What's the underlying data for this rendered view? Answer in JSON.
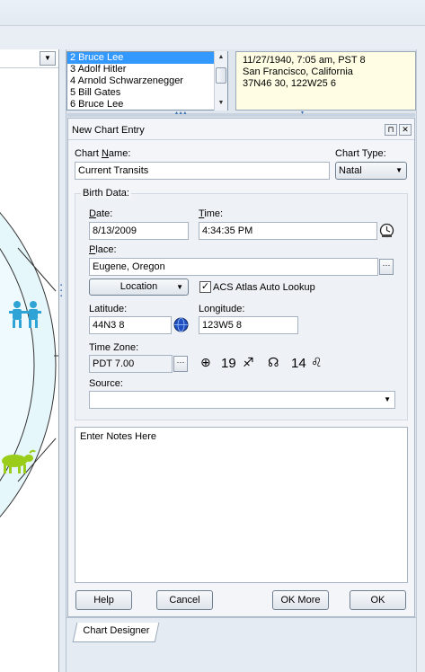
{
  "people_list": {
    "items": [
      {
        "label": "2 Bruce Lee",
        "selected": true
      },
      {
        "label": "3 Adolf Hitler",
        "selected": false
      },
      {
        "label": "4 Arnold Schwarzenegger",
        "selected": false
      },
      {
        "label": "5 Bill Gates",
        "selected": false
      },
      {
        "label": "6 Bruce Lee",
        "selected": false
      }
    ]
  },
  "info_box": {
    "line1": "11/27/1940, 7:05 am, PST 8",
    "line2": "San Francisco, California",
    "line3": "37N46 30, 122W25 6"
  },
  "panel": {
    "title": "New Chart Entry",
    "pin_glyph": "📌",
    "close_glyph": "✕"
  },
  "chart_name": {
    "label_pre": "Chart ",
    "label_mnemonic": "N",
    "label_post": "ame:",
    "value": "Current Transits"
  },
  "chart_type": {
    "label": "Chart Type:",
    "value": "Natal"
  },
  "birth_data": {
    "group_label": "Birth Data:",
    "date_label_mnemonic": "D",
    "date_label_post": "ate:",
    "date_value": "8/13/2009",
    "time_label_mnemonic": "T",
    "time_label_post": "ime:",
    "time_value": "4:34:35 PM",
    "place_label_mnemonic": "P",
    "place_label_post": "lace:",
    "place_value": "Eugene, Oregon",
    "location_button": "Location",
    "acs_label": "ACS Atlas Auto Lookup",
    "acs_checked": true,
    "latitude_label": "Latitude:",
    "latitude_value": "44N3 8",
    "longitude_label": "Longitude:",
    "longitude_value": "123W5 8",
    "timezone_label": "Time Zone:",
    "timezone_value": "PDT 7.00",
    "asc_value": "19",
    "node_value": "14",
    "source_label": "Source:",
    "source_value": ""
  },
  "notes": {
    "placeholder": "Enter Notes Here"
  },
  "buttons": {
    "help": "Help",
    "cancel": "Cancel",
    "ok_more": "OK More",
    "ok": "OK"
  },
  "bottom_tab": {
    "label": "Chart Designer"
  },
  "colors": {
    "selection": "#3399ff",
    "info_bg": "#fffde3",
    "gemini_glyph": "#2fa3d6",
    "taurus_glyph": "#9acd1a",
    "wheel_fill": "#e6f7fb"
  },
  "icons": {
    "clock": "clock-icon",
    "globe": "globe-icon",
    "ellipsis": "ellipsis-icon",
    "asc_sign": "sagittarius-icon",
    "node_sign": "leo-icon"
  }
}
